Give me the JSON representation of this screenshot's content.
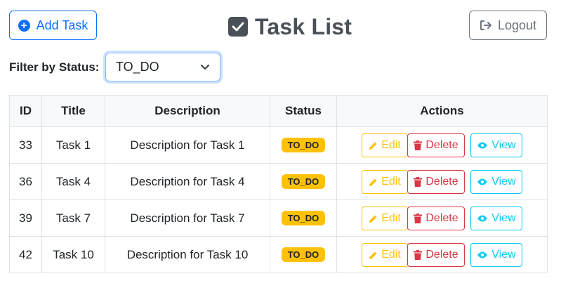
{
  "header": {
    "add_task_label": "Add Task",
    "title": "Task List",
    "logout_label": "Logout"
  },
  "filter": {
    "label": "Filter by Status:",
    "selected": "TO_DO"
  },
  "table": {
    "columns": [
      "ID",
      "Title",
      "Description",
      "Status",
      "Actions"
    ],
    "rows": [
      {
        "id": "33",
        "title": "Task 1",
        "description": "Description for Task 1",
        "status": "TO_DO"
      },
      {
        "id": "36",
        "title": "Task 4",
        "description": "Description for Task 4",
        "status": "TO_DO"
      },
      {
        "id": "39",
        "title": "Task 7",
        "description": "Description for Task 7",
        "status": "TO_DO"
      },
      {
        "id": "42",
        "title": "Task 10",
        "description": "Description for Task 10",
        "status": "TO_DO"
      }
    ],
    "actions": {
      "edit": "Edit",
      "delete": "Delete",
      "view": "View"
    }
  },
  "colors": {
    "primary": "#0d6efd",
    "secondary": "#6c757d",
    "warning": "#ffc107",
    "danger": "#dc3545",
    "info": "#0dcaf0",
    "title_gray": "#495057"
  },
  "icons": {
    "add": "plus-circle-icon",
    "title": "check-square-icon",
    "logout": "sign-out-icon",
    "filter": "chevron-down-icon",
    "edit": "pencil-icon",
    "delete": "trash-icon",
    "view": "eye-icon"
  }
}
